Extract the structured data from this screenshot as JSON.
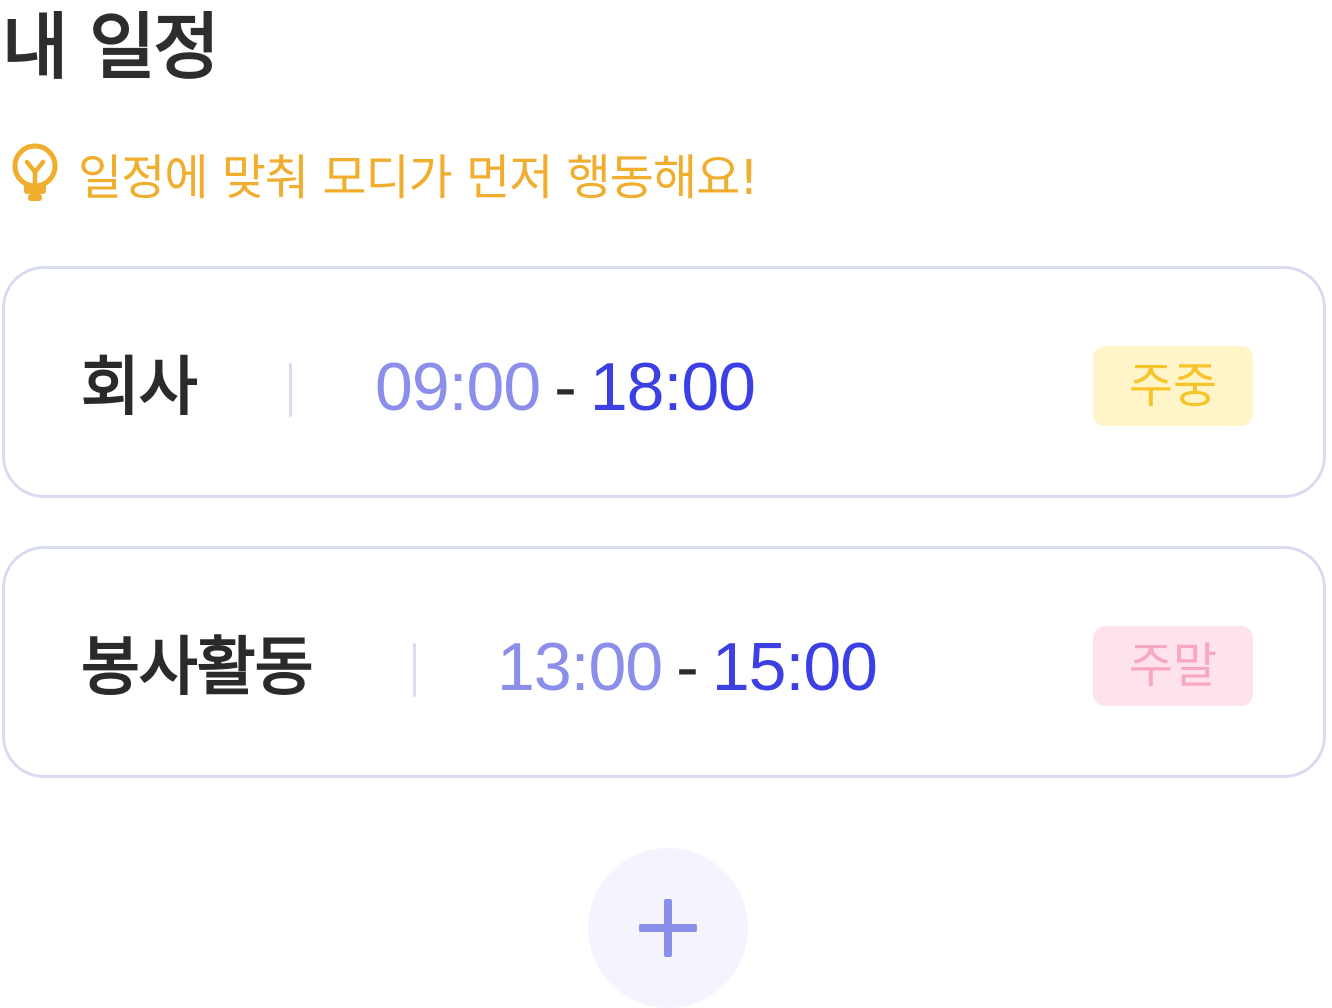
{
  "header": {
    "title": "내 일정"
  },
  "tip": {
    "icon": "lightbulb-icon",
    "text": "일정에 맞춰 모디가 먼저 행동해요!",
    "color": "#f0ad2e"
  },
  "schedules": [
    {
      "name": "회사",
      "start": "09:00",
      "separator": "-",
      "end": "18:00",
      "tag": "주중"
    },
    {
      "name": "봉사활동",
      "start": "13:00",
      "separator": "-",
      "end": "15:00",
      "tag": "주말"
    }
  ],
  "add_button": {
    "icon": "plus-icon"
  },
  "colors": {
    "accent": "#3c3fe3",
    "accent_light": "#8b8fe9",
    "card_border": "#d9dbf1",
    "weekday_badge_bg": "#fff5c8",
    "weekday_badge_text": "#f7c52b",
    "weekend_badge_bg": "#ffe3eb",
    "weekend_badge_text": "#f7a7c0",
    "add_button_bg": "#f4f4ff"
  }
}
